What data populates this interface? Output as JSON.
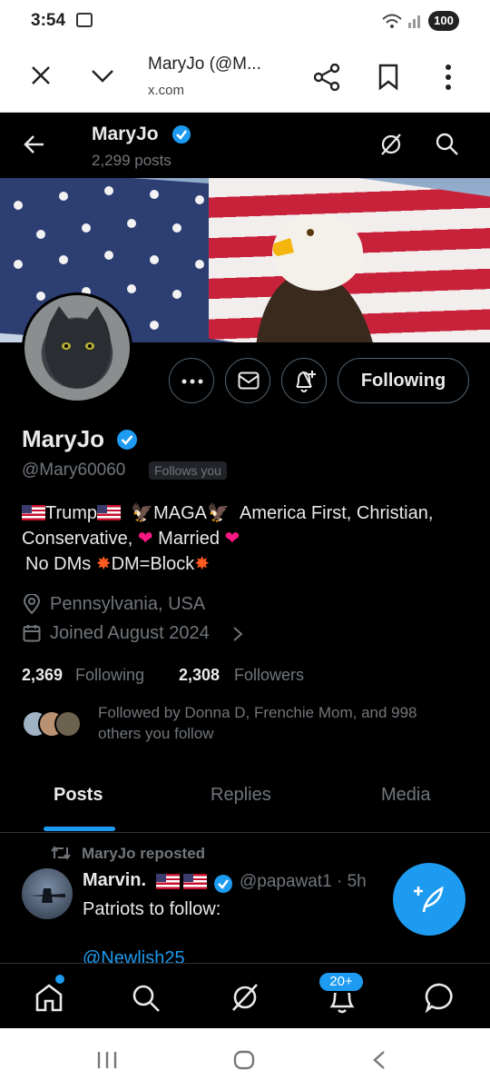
{
  "status_bar": {
    "time": "3:54",
    "battery": "100"
  },
  "browser": {
    "title": "MaryJo (@M...",
    "url": "x.com"
  },
  "header": {
    "name": "MaryJo",
    "post_count": "2,299 posts"
  },
  "profile": {
    "name": "MaryJo",
    "handle": "@Mary60060",
    "follows_you": "Follows you",
    "bio_line1_a": "Trump",
    "bio_line1_b": "MAGA",
    "bio_line1_c": "America First, Christian,",
    "bio_line2_a": "Conservative,",
    "bio_line2_b": "Married",
    "bio_line3_a": "No DMs",
    "bio_line3_b": "DM=Block",
    "location": "Pennsylvania, USA",
    "joined": "Joined August 2024",
    "following_count": "2,369",
    "following_label": "Following",
    "followers_count": "2,308",
    "followers_label": "Followers",
    "followed_by": "Followed by Donna D, Frenchie Mom, and 998",
    "followed_by_2": "others you follow",
    "following_button": "Following"
  },
  "tabs": [
    {
      "label": "Posts",
      "active": true
    },
    {
      "label": "Replies",
      "active": false
    },
    {
      "label": "Media",
      "active": false
    }
  ],
  "post": {
    "repost_label": "MaryJo reposted",
    "author": "Marvin.",
    "handle_time": "@papawat1 · 5h",
    "text": "Patriots to follow:",
    "mention": "@Newlish25"
  },
  "bottom_nav": {
    "notif_badge": "20+"
  },
  "colors": {
    "accent": "#1d9bf0",
    "background": "#000000",
    "text": "#e7e9ea",
    "muted": "#71767b"
  }
}
